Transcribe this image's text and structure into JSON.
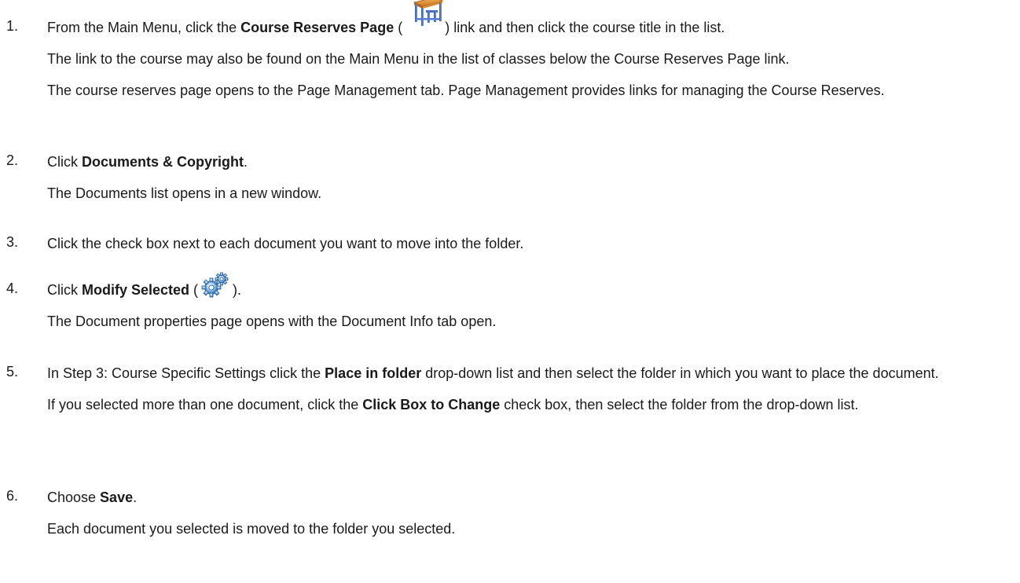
{
  "steps": [
    {
      "number": "1.",
      "pre": "From the Main Menu, click the ",
      "bold": "Course Reserves Page",
      "mid": " (",
      "icon": "course-reserves-desk-icon",
      "post": ") link and then click the course title in the list.",
      "notes": [
        "The link to the course may also be found on the Main Menu in the list of classes below the Course Reserves Page link.",
        "The course reserves page opens to the Page Management tab. Page Management provides links for managing the Course Reserves."
      ]
    },
    {
      "number": "2.",
      "pre": "Click ",
      "bold": "Documents & Copyright",
      "post": ".",
      "notes": [
        "The Documents list opens in a new window."
      ]
    },
    {
      "number": "3.",
      "text": "Click the check box next to each document you want to move into the folder."
    },
    {
      "number": "4.",
      "pre": "Click ",
      "bold": "Modify Selected",
      "mid": " (",
      "icon": "modify-gears-icon",
      "post": ").",
      "notes": [
        "The Document properties page opens with the Document Info tab open."
      ]
    },
    {
      "number": "5.",
      "pre": "In Step 3: Course Specific Settings click the ",
      "bold": "Place in folder",
      "post": " drop-down list and then select the folder in which you want to place the document.",
      "note_pre": "If you selected more than one document, click the ",
      "note_bold": "Click Box to Change",
      "note_post": " check box, then select the folder from the drop-down list."
    },
    {
      "number": "6.",
      "pre": "Choose ",
      "bold": "Save",
      "post": ".",
      "notes": [
        "Each document you selected is moved to the folder you selected."
      ]
    }
  ]
}
